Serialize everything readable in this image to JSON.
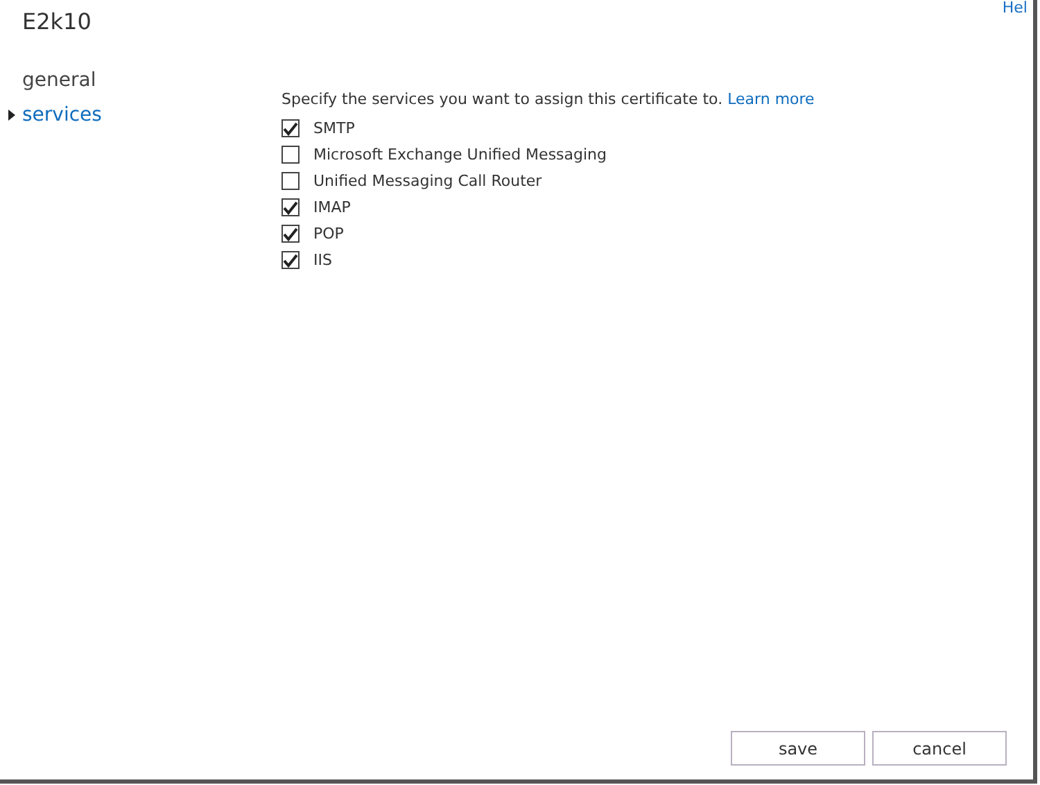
{
  "window": {
    "title": "E2k10",
    "help_link": "Hel"
  },
  "nav": [
    {
      "label": "general",
      "selected": false
    },
    {
      "label": "services",
      "selected": true
    }
  ],
  "services": {
    "intro": "Specify the services you want to assign this certificate to.",
    "learn_more": "Learn more",
    "options": [
      {
        "label": "SMTP",
        "checked": true
      },
      {
        "label": "Microsoft Exchange Unified Messaging",
        "checked": false
      },
      {
        "label": "Unified Messaging Call Router",
        "checked": false
      },
      {
        "label": "IMAP",
        "checked": true
      },
      {
        "label": "POP",
        "checked": true
      },
      {
        "label": "IIS",
        "checked": true
      }
    ]
  },
  "buttons": [
    "save",
    "cancel"
  ]
}
